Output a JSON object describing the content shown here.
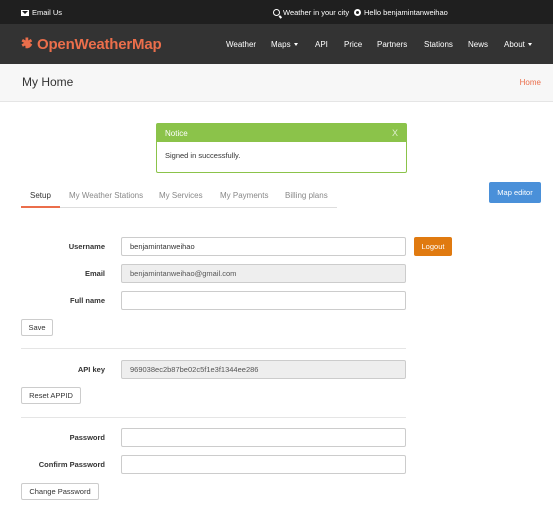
{
  "topbar": {
    "email_label": "Email Us",
    "weather_city_label": "Weather in your city",
    "hello_label": "Hello benjamintanweihao"
  },
  "navbar": {
    "logo_text": "OpenWeatherMap",
    "items": [
      {
        "label": "Weather"
      },
      {
        "label": "Maps"
      },
      {
        "label": "API"
      },
      {
        "label": "Price"
      },
      {
        "label": "Partners"
      },
      {
        "label": "Stations"
      },
      {
        "label": "News"
      },
      {
        "label": "About"
      }
    ]
  },
  "header": {
    "title": "My Home",
    "breadcrumb": "Home"
  },
  "notice": {
    "title": "Notice",
    "close": "X",
    "message": "Signed in successfully."
  },
  "tabs": [
    {
      "label": "Setup"
    },
    {
      "label": "My Weather Stations"
    },
    {
      "label": "My Services"
    },
    {
      "label": "My Payments"
    },
    {
      "label": "Billing plans"
    }
  ],
  "map_editor_label": "Map editor",
  "form": {
    "username_label": "Username",
    "username_value": "benjamintanweihao",
    "logout_label": "Logout",
    "email_label": "Email",
    "email_value": "benjamintanweihao@gmail.com",
    "fullname_label": "Full name",
    "fullname_value": "",
    "save_label": "Save",
    "apikey_label": "API key",
    "apikey_value": "969038ec2b87be02c5f1e3f1344ee286",
    "reset_label": "Reset APPID",
    "password_label": "Password",
    "confirm_label": "Confirm Password",
    "change_password_label": "Change Password"
  },
  "colors": {
    "accent": "#eb6e4b",
    "notice_green": "#8bc34a",
    "map_editor_blue": "#4a90d9",
    "logout_orange": "#e07a10"
  }
}
